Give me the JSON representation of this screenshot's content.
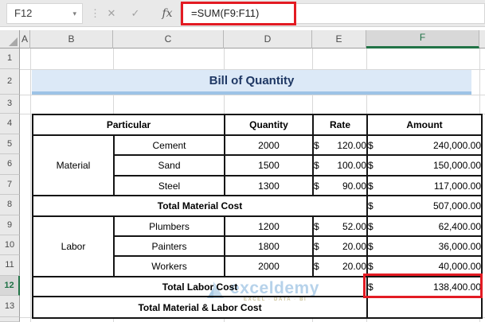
{
  "formula_bar": {
    "name_box": "F12",
    "formula": "=SUM(F9:F11)",
    "icons": {
      "dropdown": "▾",
      "grip": "⋮",
      "cancel": "✕",
      "enter": "✓",
      "function": "fx"
    }
  },
  "grid": {
    "column_headers": [
      "A",
      "B",
      "C",
      "D",
      "E",
      "F"
    ],
    "row_headers": [
      "1",
      "2",
      "3",
      "4",
      "5",
      "6",
      "7",
      "8",
      "9",
      "10",
      "11",
      "12",
      "13"
    ],
    "selected_cell": "F12",
    "selected_column": "F",
    "selected_row": "12"
  },
  "sheet": {
    "title": "Bill of Quantity",
    "currency": "$",
    "table": {
      "headers": {
        "particular": "Particular",
        "quantity": "Quantity",
        "rate": "Rate",
        "amount": "Amount"
      },
      "groups": [
        {
          "label": "Material",
          "rows": [
            {
              "item": "Cement",
              "quantity": "2000",
              "rate": "120.00",
              "amount": "240,000.00"
            },
            {
              "item": "Sand",
              "quantity": "1500",
              "rate": "100.00",
              "amount": "150,000.00"
            },
            {
              "item": "Steel",
              "quantity": "1300",
              "rate": "90.00",
              "amount": "117,000.00"
            }
          ],
          "total_label": "Total Material Cost",
          "total_amount": "507,000.00"
        },
        {
          "label": "Labor",
          "rows": [
            {
              "item": "Plumbers",
              "quantity": "1200",
              "rate": "52.00",
              "amount": "62,400.00"
            },
            {
              "item": "Painters",
              "quantity": "1800",
              "rate": "20.00",
              "amount": "36,000.00"
            },
            {
              "item": "Workers",
              "quantity": "2000",
              "rate": "20.00",
              "amount": "40,000.00"
            }
          ],
          "total_label": "Total Labor Cost",
          "total_amount": "138,400.00"
        }
      ],
      "grand_total_label": "Total Material & Labor Cost"
    }
  },
  "watermark": {
    "text": "exceldemy",
    "subtext": "EXCEL · DATA · BI"
  },
  "colors": {
    "selection_green": "#217346",
    "title_bg": "#DCE9F7",
    "title_text": "#1F3864",
    "title_border": "#9DC3E6",
    "table_header_bg": "#E2EFDA",
    "grand_total_bg": "#FFF2CC",
    "annotation_red": "#E31B23",
    "watermark_blue": "#AECDE8"
  }
}
